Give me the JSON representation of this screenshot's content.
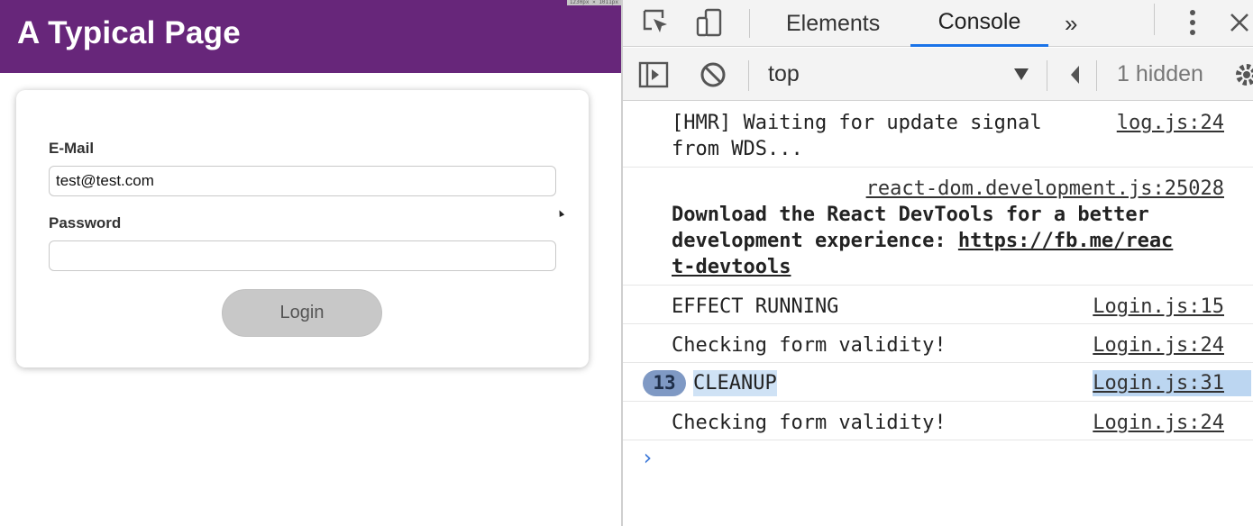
{
  "app": {
    "title": "A Typical Page",
    "size_tooltip": "1230px × 1011px",
    "form": {
      "email_label": "E-Mail",
      "email_value": "test@test.com",
      "password_label": "Password",
      "password_value": "",
      "login_label": "Login"
    }
  },
  "devtools": {
    "tabs": [
      {
        "label": "Elements",
        "active": false
      },
      {
        "label": "Console",
        "active": true
      }
    ],
    "more_tabs_icon": "»",
    "context": "top",
    "hidden_count": "1 hidden",
    "console": [
      {
        "text1": "[HMR] Waiting for update signal",
        "text2": "from WDS...",
        "source": "log.js:24"
      },
      {
        "source": "react-dom.development.js:25028",
        "text1": "Download the React DevTools for a better",
        "text2": "development experience: ",
        "link1": "https://fb.me/reac",
        "link2": "t-devtools"
      },
      {
        "text1": "EFFECT RUNNING",
        "source": "Login.js:15"
      },
      {
        "text1": "Checking form validity!",
        "source": "Login.js:24"
      },
      {
        "count": "13",
        "text1": "CLEANUP",
        "source": "Login.js:31"
      },
      {
        "text1": "Checking form validity!",
        "source": "Login.js:24"
      }
    ],
    "prompt": "›"
  },
  "colors": {
    "header": "#67267a",
    "active_tab": "#1a73e8",
    "selection": "#cfe2f5",
    "badge": "#7f99c4"
  }
}
